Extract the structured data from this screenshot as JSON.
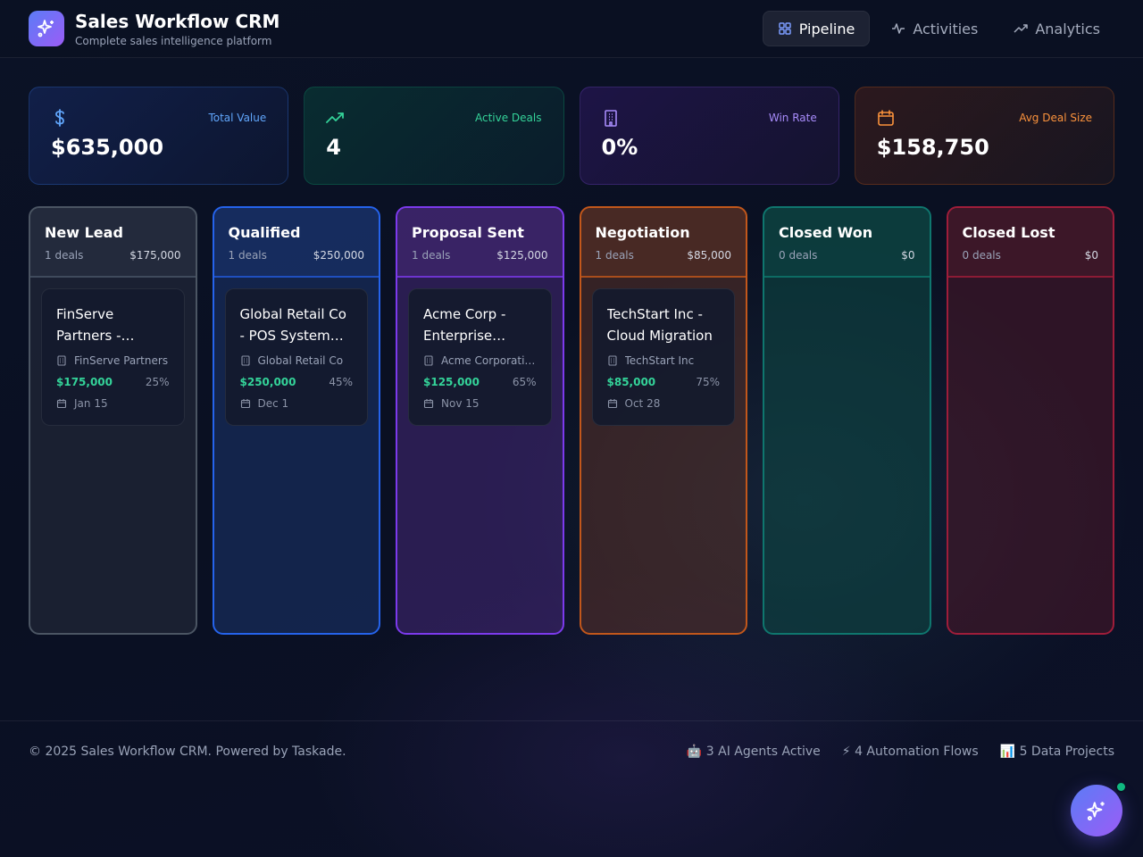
{
  "app": {
    "title": "Sales Workflow CRM",
    "subtitle": "Complete sales intelligence platform"
  },
  "nav": [
    {
      "label": "Pipeline",
      "icon": "grid-icon",
      "active": true
    },
    {
      "label": "Activities",
      "icon": "activity-icon",
      "active": false
    },
    {
      "label": "Analytics",
      "icon": "trending-up-icon",
      "active": false
    }
  ],
  "stats": [
    {
      "label": "Total Value",
      "value": "$635,000",
      "icon": "dollar-icon",
      "color": "#60a5fa"
    },
    {
      "label": "Active Deals",
      "value": "4",
      "icon": "trending-up-icon",
      "color": "#34d399"
    },
    {
      "label": "Win Rate",
      "value": "0%",
      "icon": "building-icon",
      "color": "#a78bfa"
    },
    {
      "label": "Avg Deal Size",
      "value": "$158,750",
      "icon": "calendar-icon",
      "color": "#fb923c"
    }
  ],
  "columns": [
    {
      "title": "New Lead",
      "count": "1 deals",
      "total": "$175,000",
      "color": "#4b5563",
      "card": {
        "title": "FinServe Partners - Financial Platform",
        "company": "FinServe Partners",
        "amount": "$175,000",
        "probability": "25%",
        "date": "Jan 15"
      }
    },
    {
      "title": "Qualified",
      "count": "1 deals",
      "total": "$250,000",
      "color": "#2563eb",
      "card": {
        "title": "Global Retail Co - POS System Upgrade",
        "company": "Global Retail Co",
        "amount": "$250,000",
        "probability": "45%",
        "date": "Dec 1"
      }
    },
    {
      "title": "Proposal Sent",
      "count": "1 deals",
      "total": "$125,000",
      "color": "#7c3aed",
      "card": {
        "title": "Acme Corp - Enterprise License",
        "company": "Acme Corporation",
        "amount": "$125,000",
        "probability": "65%",
        "date": "Nov 15"
      }
    },
    {
      "title": "Negotiation",
      "count": "1 deals",
      "total": "$85,000",
      "color": "#ea580c",
      "card": {
        "title": "TechStart Inc - Cloud Migration",
        "company": "TechStart Inc",
        "amount": "$85,000",
        "probability": "75%",
        "date": "Oct 28"
      }
    },
    {
      "title": "Closed Won",
      "count": "0 deals",
      "total": "$0",
      "color": "#0d9488",
      "card": null
    },
    {
      "title": "Closed Lost",
      "count": "0 deals",
      "total": "$0",
      "color": "#be123c",
      "card": null
    }
  ],
  "footer": {
    "copyright": "© 2025 Sales Workflow CRM. Powered by Taskade.",
    "agents": "🤖 3 AI Agents Active",
    "flows": "⚡ 4 Automation Flows",
    "projects": "📊 5 Data Projects"
  }
}
